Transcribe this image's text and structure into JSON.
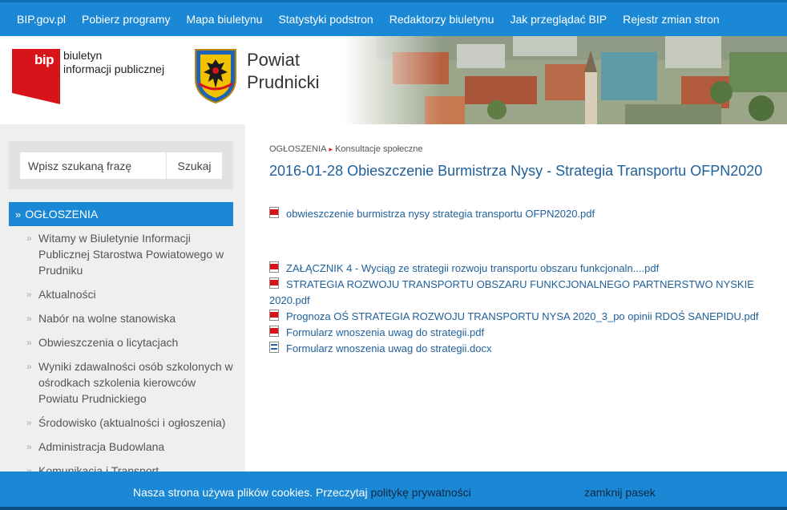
{
  "topnav": {
    "items": [
      "BIP.gov.pl",
      "Pobierz programy",
      "Mapa biuletynu",
      "Statystyki podstron",
      "Redaktorzy biuletynu",
      "Jak przeglądać BIP",
      "Rejestr zmian stron"
    ]
  },
  "header": {
    "bip_logo_text": "bip",
    "bip_line1": "biuletyn",
    "bip_line2": "informacji publicznej",
    "powiat_line1": "Powiat",
    "powiat_line2": "Prudnicki"
  },
  "search": {
    "placeholder": "Wpisz szukaną frazę",
    "button": "Szukaj"
  },
  "menu": {
    "active": "OGŁOSZENIA",
    "items": [
      "Witamy w Biuletynie Informacji Publicznej Starostwa Powiatowego w Prudniku",
      "Aktualności",
      "Nabór na wolne stanowiska",
      "Obwieszczenia o licytacjach",
      "Wyniki zdawalności osób szkolonych w ośrodkach szkolenia kierowców Powiatu Prudnickiego",
      "Środowisko (aktualności i ogłoszenia)",
      "Administracja Budowlana",
      "Komunikacja i Transport"
    ]
  },
  "breadcrumb": {
    "root": "OGŁOSZENIA",
    "current": "Konsultacje społeczne"
  },
  "page_title": "2016-01-28 Obieszczenie Burmistrza Nysy - Strategia Transportu OFPN2020",
  "attachments": {
    "first": "obwieszczenie burmistrza nysy strategia transportu OFPN2020.pdf",
    "list": [
      "ZAŁĄCZNIK 4 - Wyciąg ze strategii rozwoju transportu obszaru funkcjonaln....pdf",
      "STRATEGIA ROZWOJU TRANSPORTU OBSZARU FUNKCJONALNEGO PARTNERSTWO NYSKIE 2020.pdf",
      "Prognoza OŚ STRATEGIA ROZWOJU TRANSPORTU NYSA 2020_3_po opinii RDOŚ SANEPIDU.pdf",
      "Formularz wnoszenia uwag do strategii.pdf",
      "Formularz wnoszenia uwag do strategii.docx"
    ]
  },
  "cookie": {
    "message": "Nasza strona używa plików cookies. Przeczytaj",
    "link": "politykę prywatności",
    "close": "zamknij pasek"
  },
  "colors": {
    "brand_blue": "#1a88d4",
    "link_blue": "#1f5f9a",
    "bip_red": "#d7141a"
  }
}
